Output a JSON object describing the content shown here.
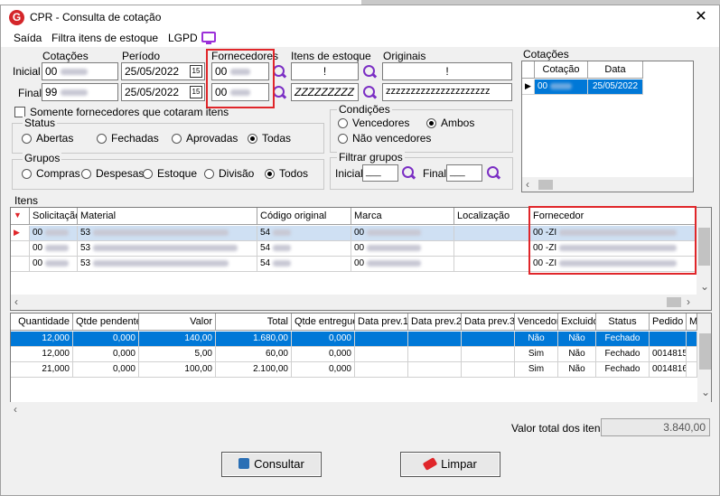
{
  "window": {
    "title": "CPR - Consulta de cotação",
    "close_symbol": "✕",
    "icon_letter": "G"
  },
  "menu": {
    "items": [
      "Saída",
      "Filtra itens de estoque",
      "LGPD"
    ]
  },
  "filters": {
    "row_labels": [
      "Inicial",
      "Final"
    ],
    "cotacoes": {
      "label": "Cotações",
      "inicial": "00",
      "final": "99"
    },
    "periodo": {
      "label": "Período",
      "inicial": "25/05/2022",
      "final": "25/05/2022",
      "cal_label": "15"
    },
    "fornecedores": {
      "label": "Fornecedores",
      "inicial": "00",
      "final": "00"
    },
    "itens_estoque": {
      "label": "Itens de estoque",
      "inicial": "!",
      "final": "ZZZZZZZZZ"
    },
    "originais": {
      "label": "Originais",
      "inicial": "!",
      "final": "zzzzzzzzzzzzzzzzzzzzz"
    },
    "somente_label": "Somente fornecedores que cotaram itens"
  },
  "status_group": {
    "title": "Status",
    "options": [
      "Abertas",
      "Fechadas",
      "Aprovadas",
      "Todas"
    ],
    "selected": "Todas"
  },
  "grupos_group": {
    "title": "Grupos",
    "options": [
      "Compras",
      "Despesas",
      "Estoque",
      "Divisão",
      "Todos"
    ],
    "selected": "Todos"
  },
  "condicoes_group": {
    "title": "Condições",
    "options": [
      "Vencedores",
      "Ambos",
      "Não vencedores"
    ],
    "selected": "Ambos"
  },
  "filtrar_grupos": {
    "title": "Filtrar grupos",
    "inicial_label": "Inicial",
    "final_label": "Final",
    "inicial_value": "___",
    "final_value": "___"
  },
  "cotacoes_panel": {
    "title": "Cotações",
    "headers": [
      "Cotação",
      "Data"
    ],
    "rows": [
      {
        "cotacao": "00",
        "data": "25/05/2022"
      }
    ]
  },
  "itens": {
    "title": "Itens",
    "headers": [
      "Solicitação",
      "Material",
      "Código original",
      "Marca",
      "Localização",
      "Fornecedor"
    ],
    "rows": [
      {
        "solicitacao": "00",
        "material": "53",
        "codigo": "54",
        "marca": "00",
        "localizacao": "",
        "fornecedor": "00 -ZI"
      },
      {
        "solicitacao": "00",
        "material": "53",
        "codigo": "54",
        "marca": "00",
        "localizacao": "",
        "fornecedor": "00 -ZI"
      },
      {
        "solicitacao": "00",
        "material": "53",
        "codigo": "54",
        "marca": "00",
        "localizacao": "",
        "fornecedor": "00 -ZI"
      }
    ]
  },
  "detalhes": {
    "headers": [
      "Quantidade",
      "Qtde pendente",
      "Valor",
      "Total",
      "Qtde entregue",
      "Data prev.1",
      "Data prev.2",
      "Data prev.3",
      "Vencedor",
      "Excluido",
      "Status",
      "Pedido",
      "M"
    ],
    "rows": [
      {
        "quantidade": "12,000",
        "pendente": "0,000",
        "valor": "140,00",
        "total": "1.680,00",
        "entregue": "0,000",
        "vencedor": "Não",
        "excluido": "Não",
        "status": "Fechado",
        "pedido": ""
      },
      {
        "quantidade": "12,000",
        "pendente": "0,000",
        "valor": "5,00",
        "total": "60,00",
        "entregue": "0,000",
        "vencedor": "Sim",
        "excluido": "Não",
        "status": "Fechado",
        "pedido": "0014815"
      },
      {
        "quantidade": "21,000",
        "pendente": "0,000",
        "valor": "100,00",
        "total": "2.100,00",
        "entregue": "0,000",
        "vencedor": "Sim",
        "excluido": "Não",
        "status": "Fechado",
        "pedido": "0014816"
      }
    ]
  },
  "footer": {
    "total_label": "Valor total dos itens",
    "total_value": "3.840,00",
    "consultar_label": "Consultar",
    "limpar_label": "Limpar"
  },
  "colors": {
    "selection": "#0078d7",
    "highlight": "#e0262a",
    "icon_purple": "#7b2fc4"
  }
}
